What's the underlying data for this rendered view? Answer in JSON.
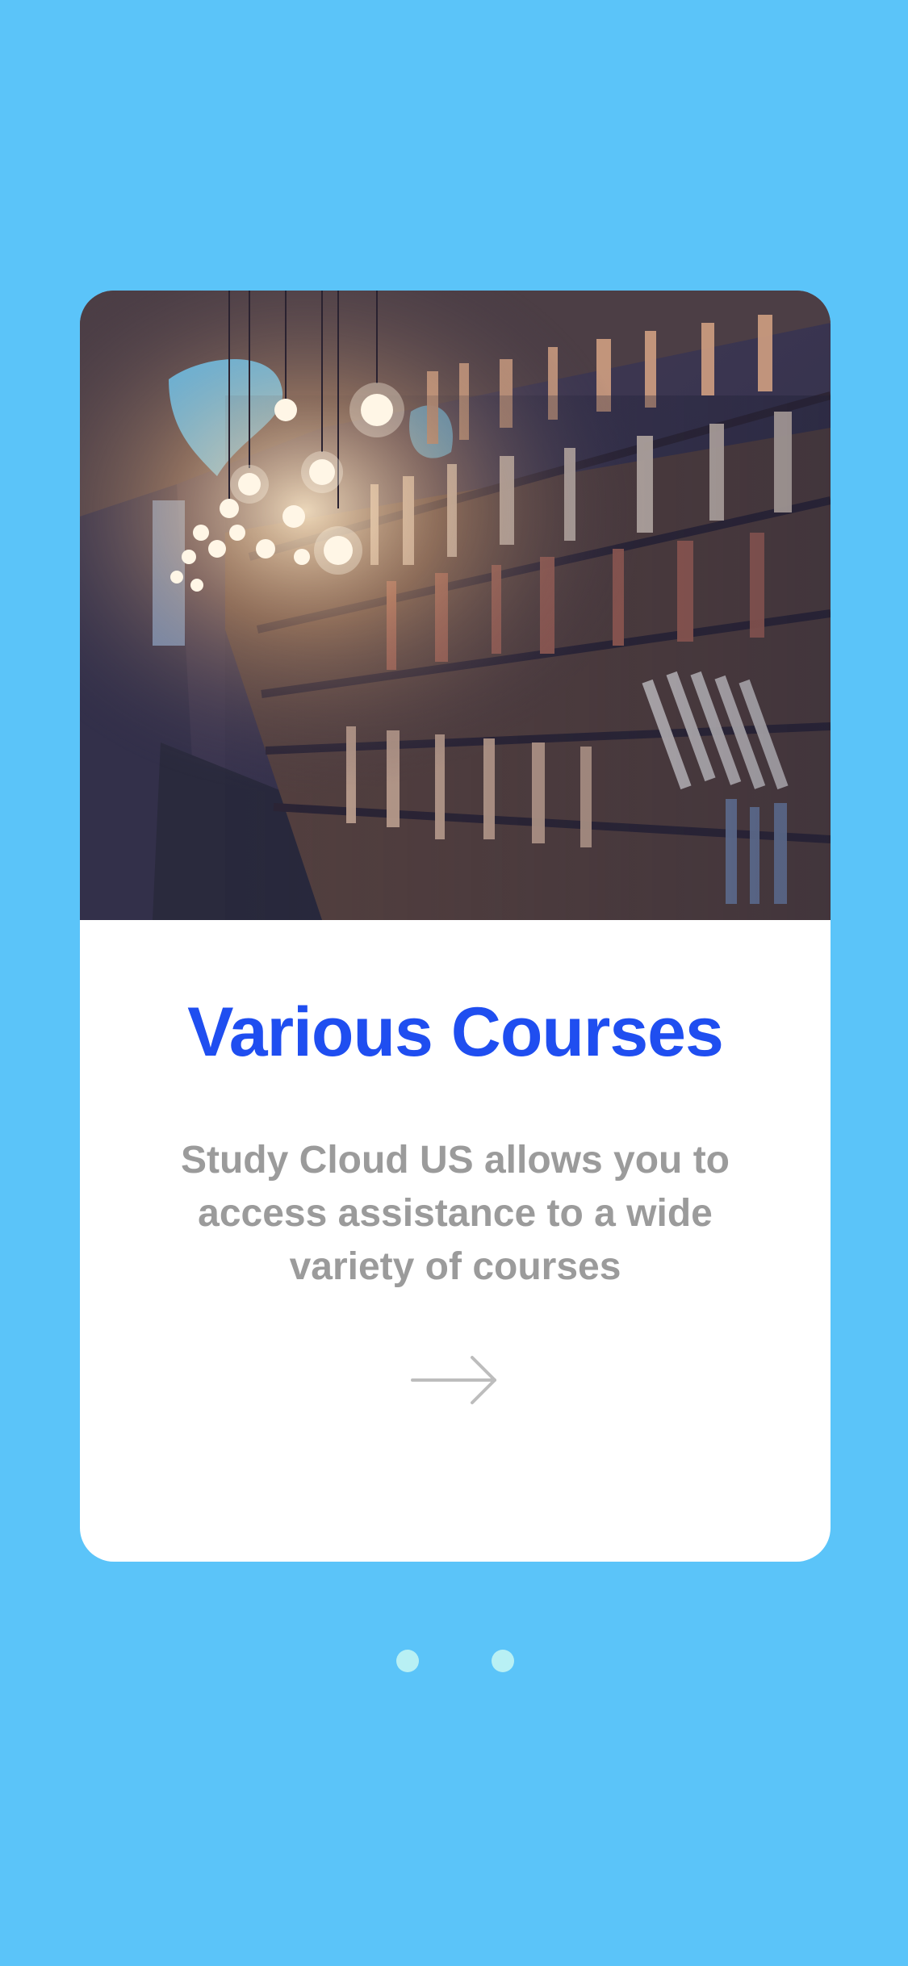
{
  "screen": {
    "background_color": "#5bc4f9"
  },
  "card": {
    "image": {
      "description_icon": "library-bookshelves-photo"
    },
    "title": "Various Courses",
    "description": "Study Cloud US allows you to access assistance to a wide variety of courses",
    "next_icon": "arrow-right-icon",
    "title_color": "#1f4ef0",
    "description_color": "#9b9b9b"
  },
  "pagination": {
    "dots": [
      {
        "name": "page-dot-1"
      },
      {
        "name": "page-dot-2"
      }
    ],
    "dot_color": "#b8f0f4"
  }
}
